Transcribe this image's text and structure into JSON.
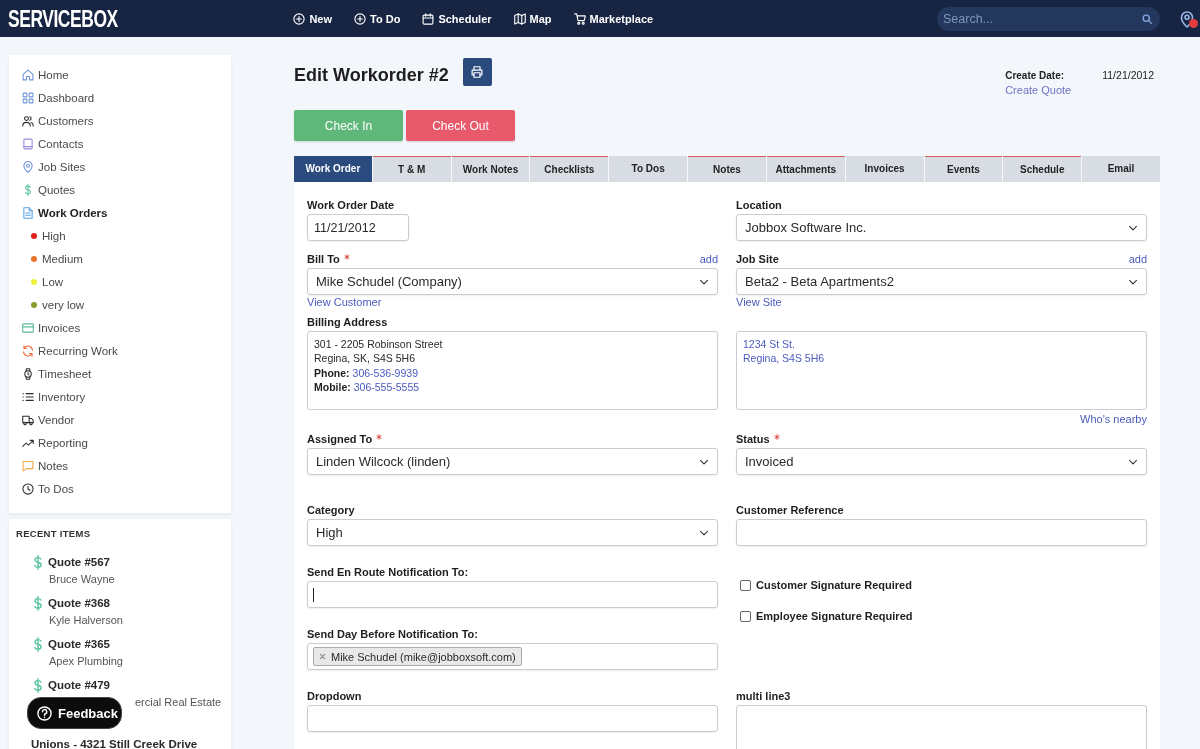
{
  "top_bar": {
    "logo": "SERVICEBOX",
    "nav": [
      {
        "label": "New"
      },
      {
        "label": "To Do"
      },
      {
        "label": "Scheduler"
      },
      {
        "label": "Map"
      },
      {
        "label": "Marketplace"
      }
    ],
    "search": {
      "placeholder": "Search..."
    }
  },
  "sidebar": {
    "items": [
      {
        "label": "Home",
        "selected": false
      },
      {
        "label": "Dashboard",
        "selected": false
      },
      {
        "label": "Customers",
        "selected": false
      },
      {
        "label": "Contacts",
        "selected": false
      },
      {
        "label": "Job Sites",
        "selected": false
      },
      {
        "label": "Quotes",
        "selected": false
      },
      {
        "label": "Work Orders",
        "selected": true,
        "children": [
          {
            "label": "High",
            "color": "#e0201b",
            "selected": false
          },
          {
            "label": "Medium",
            "color": "#e8742a",
            "selected": false
          },
          {
            "label": "Low",
            "color": "#f0f23a",
            "selected": false
          },
          {
            "label": "very low",
            "color": "#8c9a2a",
            "selected": false
          }
        ]
      },
      {
        "label": "Invoices",
        "selected": false
      },
      {
        "label": "Recurring Work",
        "selected": false
      },
      {
        "label": "Timesheet",
        "selected": false
      },
      {
        "label": "Inventory",
        "selected": false
      },
      {
        "label": "Vendor",
        "selected": false
      },
      {
        "label": "Reporting",
        "selected": false
      },
      {
        "label": "Notes",
        "selected": false
      },
      {
        "label": "To Dos",
        "selected": false
      }
    ]
  },
  "recent_items": {
    "title": "RECENT ITEMS",
    "items": [
      {
        "kind": "quote",
        "title": "Quote #567",
        "subtitle": "Bruce Wayne"
      },
      {
        "kind": "quote",
        "title": "Quote #368",
        "subtitle": "Kyle Halverson"
      },
      {
        "kind": "quote",
        "title": "Quote #365",
        "subtitle": "Apex Plumbing"
      },
      {
        "kind": "quote",
        "title": "Quote #479",
        "subtitle": "ercial Real Estate"
      },
      {
        "kind": "site",
        "title": "Unions - 4321 Still Creek Drive"
      }
    ]
  },
  "feedback_button": {
    "label": "Feedback"
  },
  "page_header": {
    "title": "Edit Workorder #2",
    "create_date": {
      "label": "Create Date:",
      "value": "11/21/2012"
    },
    "create_quote": "Create Quote"
  },
  "action_buttons": [
    {
      "kind": "check-in",
      "label": "Check In"
    },
    {
      "kind": "check-out",
      "label": "Check Out"
    }
  ],
  "tabs": [
    {
      "label": "Work Order",
      "selected": true,
      "flagged": false
    },
    {
      "label": "T & M",
      "selected": false,
      "flagged": true
    },
    {
      "label": "Work Notes",
      "selected": false,
      "flagged": true
    },
    {
      "label": "Checklists",
      "selected": false,
      "flagged": true
    },
    {
      "label": "To Dos",
      "selected": false,
      "flagged": false
    },
    {
      "label": "Notes",
      "selected": false,
      "flagged": true
    },
    {
      "label": "Attachments",
      "selected": false,
      "flagged": true
    },
    {
      "label": "Invoices",
      "selected": false,
      "flagged": false
    },
    {
      "label": "Events",
      "selected": false,
      "flagged": true
    },
    {
      "label": "Schedule",
      "selected": false,
      "flagged": true
    },
    {
      "label": "Email",
      "selected": false,
      "flagged": false
    }
  ],
  "form": {
    "rows": [
      {
        "left": [
          {
            "kind": "date",
            "label": "Work Order Date",
            "value": "11/21/2012"
          }
        ],
        "right": [
          {
            "kind": "select",
            "label": "Location",
            "value": "Jobbox Software Inc."
          }
        ]
      },
      {
        "left": [
          {
            "kind": "select",
            "label": "Bill To",
            "required": true,
            "action": "add",
            "value": "Mike Schudel (Company)",
            "link": "View Customer"
          }
        ],
        "right": [
          {
            "kind": "select",
            "label": "Job Site",
            "action": "add",
            "value": "Beta2 - Beta Apartments2",
            "link": "View Site"
          }
        ]
      },
      {
        "left": [
          {
            "kind": "address",
            "label": "Billing Address",
            "lines": [
              "301 - 2205 Robinson Street",
              "Regina, SK, S4S 5H6"
            ],
            "contacts": [
              {
                "label": "Phone:",
                "value": "306-536-9939"
              },
              {
                "label": "Mobile:",
                "value": "306-555-5555"
              }
            ]
          }
        ],
        "right": [
          {
            "kind": "site-address",
            "lines": [
              "1234 St St.",
              "Regina, S4S 5H6"
            ],
            "link": "Who's nearby"
          }
        ]
      },
      {
        "left": [
          {
            "kind": "select",
            "label": "Assigned To",
            "required": true,
            "value": "Linden Wilcock (linden)"
          }
        ],
        "right": [
          {
            "kind": "select",
            "label": "Status",
            "required": true,
            "value": "Invoiced"
          }
        ]
      },
      {
        "left": [
          {
            "kind": "select",
            "label": "Category",
            "value": "High"
          }
        ],
        "right": [
          {
            "kind": "text",
            "label": "Customer Reference",
            "focused": false
          }
        ]
      },
      {
        "left": [
          {
            "kind": "text",
            "label": "Send En Route Notification To:",
            "focused": true
          },
          {
            "kind": "tags",
            "label": "Send Day Before Notification To:",
            "tags": [
              "Mike Schudel (mike@jobboxsoft.com)"
            ]
          }
        ],
        "right": [
          {
            "kind": "checkbox",
            "label": "Customer Signature Required",
            "checked": false
          },
          {
            "kind": "checkbox",
            "label": "Employee Signature Required",
            "checked": false
          }
        ]
      },
      {
        "left": [
          {
            "kind": "text",
            "label": "Dropdown",
            "focused": false
          }
        ],
        "right": [
          {
            "kind": "textarea",
            "label": "multi line3"
          }
        ]
      }
    ]
  }
}
